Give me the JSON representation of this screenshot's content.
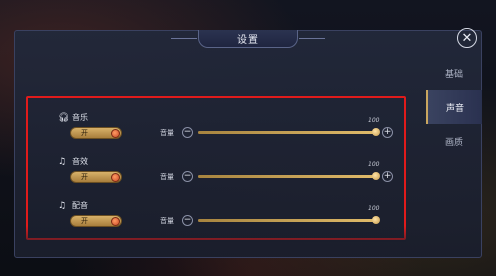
{
  "title": "设置",
  "close_icon": "close-icon",
  "sidebar": {
    "tabs": [
      {
        "label": "基础",
        "active": false
      },
      {
        "label": "声音",
        "active": true
      },
      {
        "label": "画质",
        "active": false
      }
    ]
  },
  "rows": [
    {
      "name": "音乐",
      "icon": "headphones-icon",
      "toggle_label": "开",
      "volume_label": "音量",
      "volume_value": "100",
      "volume_fraction": 1.0
    },
    {
      "name": "音效",
      "icon": "music-note-icon",
      "toggle_label": "开",
      "volume_label": "音量",
      "volume_value": "100",
      "volume_fraction": 1.0
    },
    {
      "name": "配音",
      "icon": "music-note-icon",
      "toggle_label": "开",
      "volume_label": "音量",
      "volume_value": "100",
      "volume_fraction": 1.0
    }
  ],
  "colors": {
    "accent_gold": "#d8b26a",
    "highlight_red": "#e01b1b",
    "panel_bg": "#22283a"
  }
}
